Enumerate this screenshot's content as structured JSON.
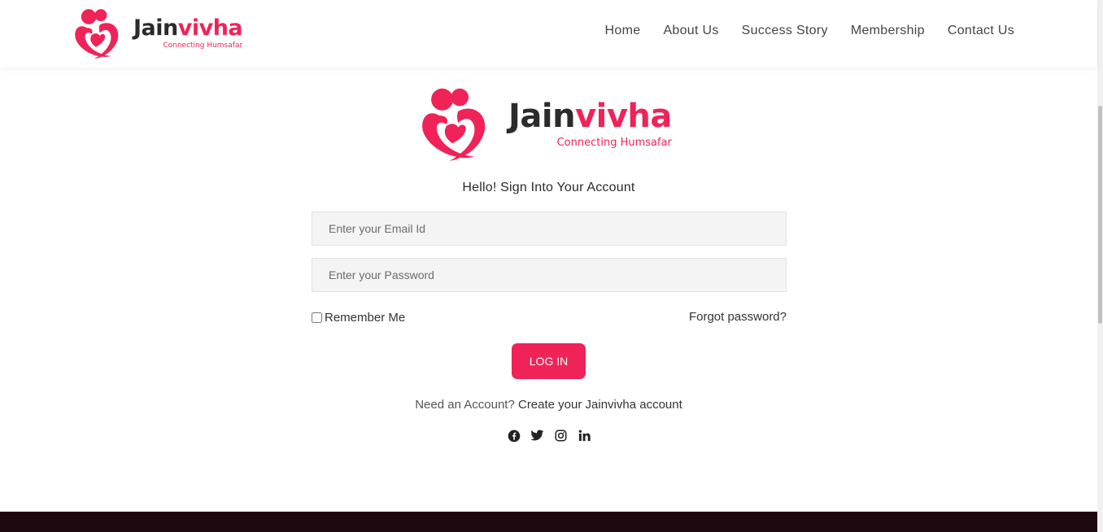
{
  "brand": {
    "name_main": "Jain",
    "name_accent": "vivha",
    "tagline": "Connecting Humsafar",
    "accent_color": "#ef2358",
    "text_color": "#2b2b2b"
  },
  "nav": {
    "items": [
      {
        "label": "Home"
      },
      {
        "label": "About Us"
      },
      {
        "label": "Success Story"
      },
      {
        "label": "Membership"
      },
      {
        "label": "Contact Us"
      }
    ]
  },
  "form": {
    "title": "Hello! Sign Into Your Account",
    "email_placeholder": "Enter your Email Id",
    "password_placeholder": "Enter your Password",
    "remember_label": "Remember Me",
    "forgot_label": "Forgot password?",
    "login_label": "LOG IN",
    "need_account_text": "Need an Account?",
    "create_account_link": "Create your Jainvivha account"
  },
  "social": [
    {
      "icon": "facebook-icon"
    },
    {
      "icon": "twitter-icon"
    },
    {
      "icon": "instagram-icon"
    },
    {
      "icon": "linkedin-icon"
    }
  ],
  "footer": {
    "color": "#1f0911"
  }
}
